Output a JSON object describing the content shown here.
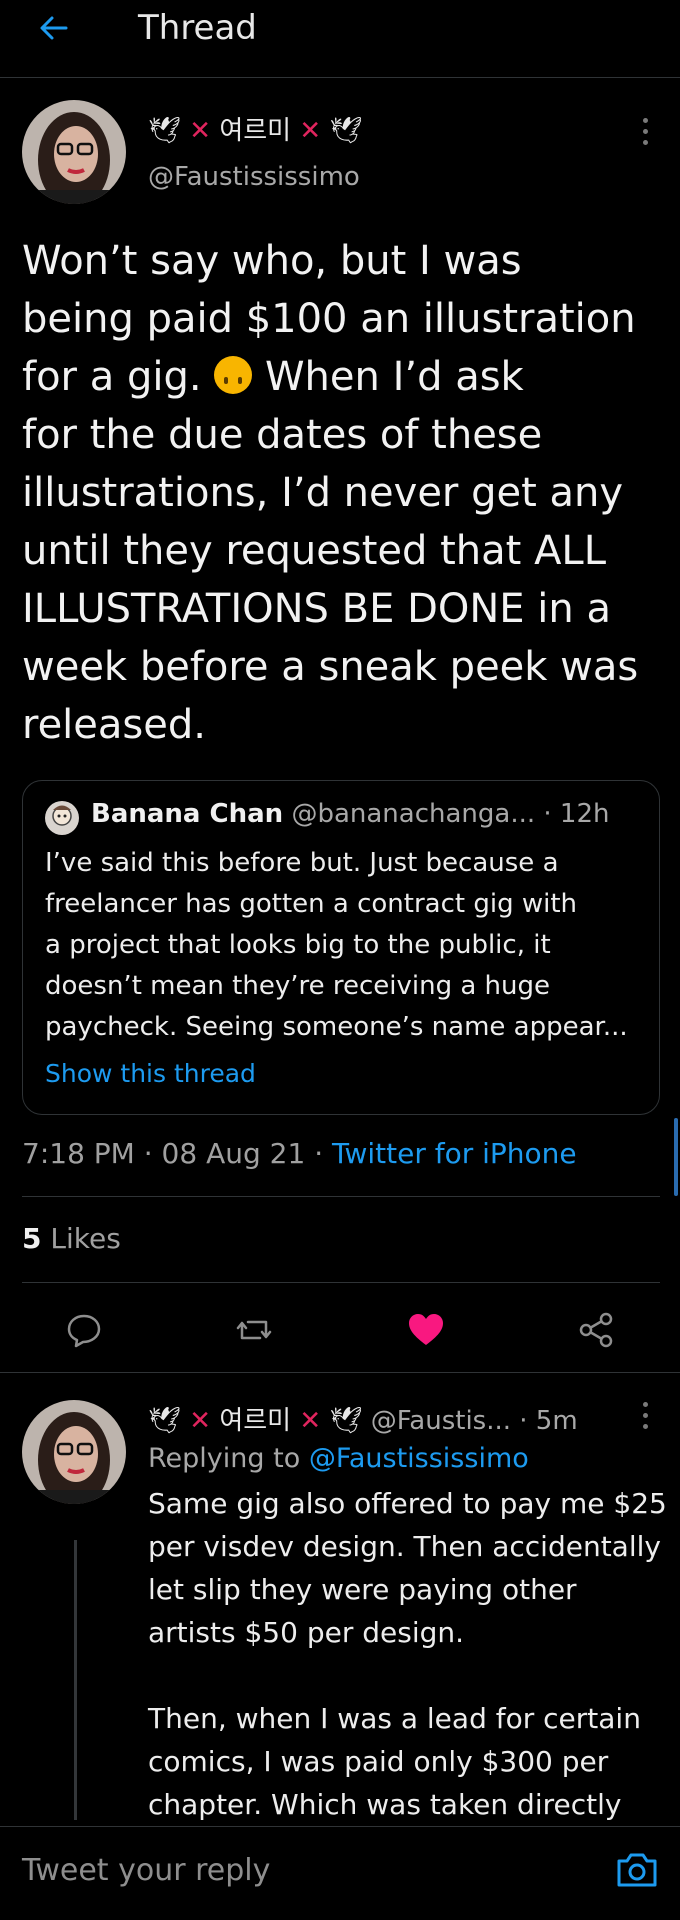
{
  "header": {
    "title": "Thread"
  },
  "tweet": {
    "name_symbol_left": "🕊",
    "name_x": "✕",
    "name_text": "여르미",
    "name_symbol_right": "🕊",
    "handle": "@Faustississimo",
    "text_lines": [
      "Won’t say who, but I was",
      "being paid $100 an illustration",
      "for a gig.",
      "When I’d ask",
      "for the due dates of these",
      "illustrations, I’d never get any",
      "until they requested that ALL",
      "ILLUSTRATIONS BE DONE in a",
      "week before a sneak peek was",
      "released."
    ],
    "quote": {
      "name": "Banana Chan",
      "handle": "@bananachanga...",
      "time": "· 12h",
      "lines": [
        "I’ve said this before but. Just because a",
        "freelancer has gotten a contract gig with",
        "a project that looks big to the public, it",
        "doesn’t mean they’re receiving a huge",
        "paycheck. Seeing someone’s name appear..."
      ],
      "show_thread": "Show this thread"
    },
    "time": "7:18 PM",
    "date": "08 Aug 21",
    "source": "Twitter for iPhone",
    "likes_count": "5",
    "likes_label": "Likes",
    "liked": true
  },
  "reply": {
    "handle": "@Faustis...",
    "time": "· 5m",
    "replying_prefix": "Replying to",
    "replying_to": "@Faustississimo",
    "lines_1": [
      "Same gig also offered to pay me $25",
      "per visdev design. Then accidentally",
      "let slip they were paying other",
      "artists $50 per design."
    ],
    "lines_2": [
      "Then, when I was a lead for certain",
      "comics, I was paid only $300 per",
      "chapter. Which was taken directly"
    ]
  },
  "reply_bar": {
    "placeholder": "Tweet your reply"
  },
  "colors": {
    "accent": "#1d9bf0",
    "like": "#f91880",
    "name_x": "#e0245e"
  },
  "icons": {
    "back": "arrow-left-icon",
    "more": "more-vertical-icon",
    "reply": "reply-icon",
    "retweet": "retweet-icon",
    "like": "heart-icon",
    "share": "share-icon",
    "camera": "camera-icon"
  }
}
